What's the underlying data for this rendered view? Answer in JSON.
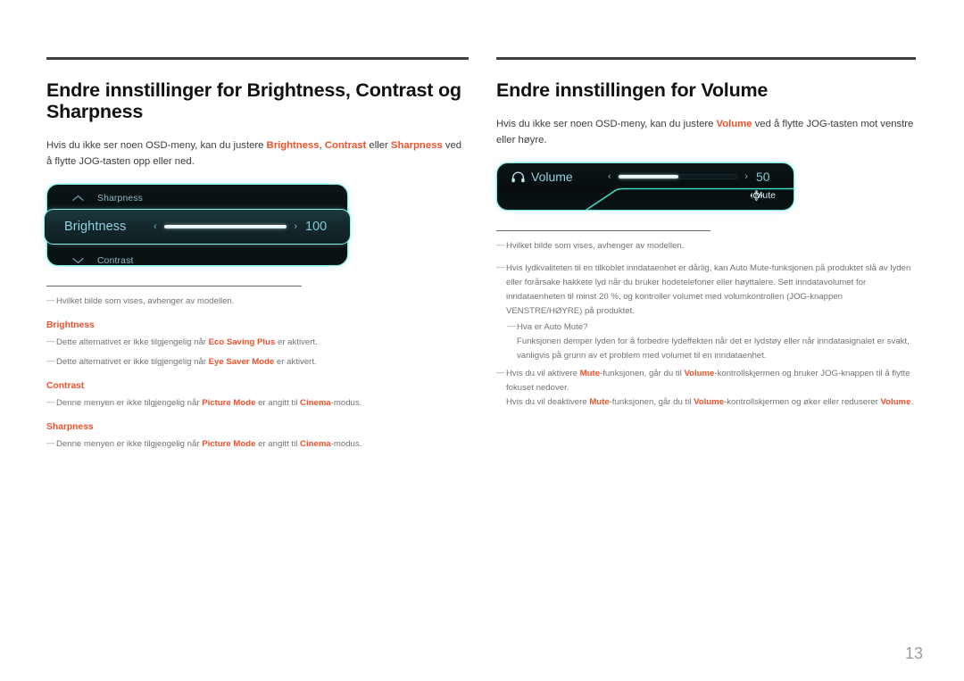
{
  "page": {
    "number": "13"
  },
  "left": {
    "title": "Endre innstillinger for Brightness, Contrast og Sharpness",
    "intro": {
      "pre": "Hvis du ikke ser noen OSD-meny, kan du justere ",
      "kw1": "Brightness",
      "sep1": ", ",
      "kw2": "Contrast",
      "sep2": " eller ",
      "kw3": "Sharpness",
      "post": " ved å flytte JOG-tasten opp eller ned."
    },
    "osd": {
      "top_row_label": "Sharpness",
      "top_row_icon": "chevron-up-icon",
      "selected_label": "Brightness",
      "selected_value": "100",
      "selected_fill_percent": 100,
      "left_arrow": "‹",
      "right_arrow": "›",
      "bottom_row_label": "Contrast",
      "bottom_row_icon": "chevron-down-icon"
    },
    "notes": {
      "model_note": "Hvilket bilde som vises, avhenger av modellen.",
      "brightness_head": "Brightness",
      "brightness_note1_pre": "Dette alternativet er ikke tilgjengelig når ",
      "brightness_note1_kw": "Eco Saving Plus",
      "brightness_note1_post": " er aktivert.",
      "brightness_note2_pre": "Dette alternativet er ikke tilgjengelig når ",
      "brightness_note2_kw": "Eye Saver Mode",
      "brightness_note2_post": " er aktivert.",
      "contrast_head": "Contrast",
      "contrast_note_pre": "Denne menyen er ikke tilgjengelig når ",
      "contrast_note_kw1": "Picture Mode",
      "contrast_note_mid": " er angitt til ",
      "contrast_note_kw2": "Cinema",
      "contrast_note_post": "-modus.",
      "sharpness_head": "Sharpness",
      "sharpness_note_pre": "Denne menyen er ikke tilgjengelig når ",
      "sharpness_note_kw1": "Picture Mode",
      "sharpness_note_mid": " er angitt til ",
      "sharpness_note_kw2": "Cinema",
      "sharpness_note_post": "-modus."
    }
  },
  "right": {
    "title": "Endre innstillingen for Volume",
    "intro": {
      "pre": "Hvis du ikke ser noen OSD-meny, kan du justere ",
      "kw1": "Volume",
      "post": " ved å flytte JOG-tasten mot venstre eller høyre."
    },
    "osd": {
      "icon": "headphone-icon",
      "label": "Volume",
      "value": "50",
      "fill_percent": 50,
      "left_arrow": "‹",
      "right_arrow": "›",
      "mute_label": "Mute",
      "mute_icon": "jog-direction-icon"
    },
    "notes": {
      "model_note": "Hvilket bilde som vises, avhenger av modellen.",
      "automute_note": "Hvis lydkvaliteten til en tilkoblet inndataenhet er dårlig, kan Auto Mute-funksjonen på produktet slå av lyden eller forårsake hakkete lyd når du bruker hodetelefoner eller høyttalere. Sett inndatavolumet for inndataenheten til minst 20 %, og kontroller volumet med volumkontrollen (JOG-knappen VENSTRE/HØYRE) på produktet.",
      "automute_q": "Hva er Auto Mute?",
      "automute_a": "Funksjonen demper lyden for å forbedre lydeffekten når det er lydstøy eller når inndatasignalet er svakt, vanligvis på grunn av et problem med volumet til en inndataenhet.",
      "mute_on_pre": "Hvis du vil aktivere ",
      "mute_on_kw1": "Mute",
      "mute_on_mid": "-funksjonen, går du til ",
      "mute_on_kw2": "Volume",
      "mute_on_post": "-kontrollskjermen og bruker JOG-knappen til å flytte fokuset nedover.",
      "mute_off_pre": "Hvis du vil deaktivere ",
      "mute_off_kw1": "Mute",
      "mute_off_mid": "-funksjonen, går du til ",
      "mute_off_kw2": "Volume",
      "mute_off_mid2": "-kontrollskjermen og øker eller reduserer ",
      "mute_off_kw3": "Volume",
      "mute_off_post": "."
    }
  },
  "colors": {
    "accent": "#f0512b",
    "osd_border": "#7fe9e3",
    "osd_text": "#8fd3e4",
    "rule": "#3f3f40"
  }
}
